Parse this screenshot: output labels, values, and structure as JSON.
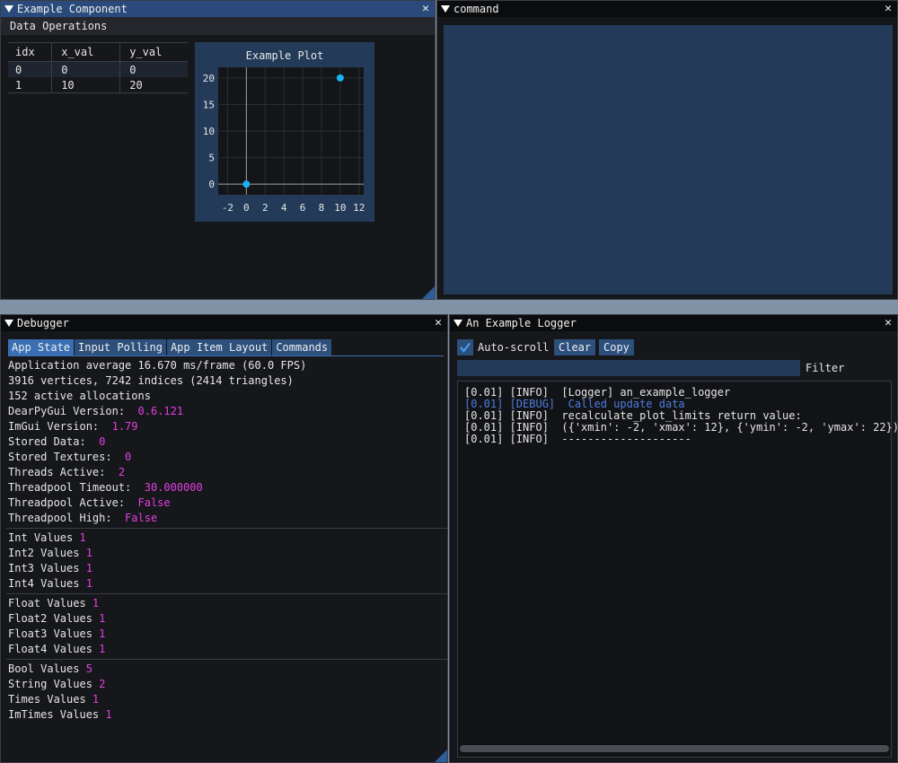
{
  "example_component": {
    "title": "Example Component",
    "menu": "Data Operations",
    "table": {
      "headers": [
        "idx",
        "x_val",
        "y_val"
      ],
      "rows": [
        [
          "0",
          "0",
          "0"
        ],
        [
          "1",
          "10",
          "20"
        ]
      ]
    }
  },
  "chart_data": {
    "type": "scatter",
    "title": "Example Plot",
    "x": [
      0,
      10
    ],
    "y": [
      0,
      20
    ],
    "xlim": [
      -3,
      12.5
    ],
    "ylim": [
      -2,
      22
    ],
    "xticks": [
      -2,
      0,
      2,
      4,
      6,
      8,
      10,
      12
    ],
    "yticks": [
      0,
      5,
      10,
      15,
      20
    ],
    "grid": true,
    "point_color": "#19b3f0",
    "axis_color": "#a0a0a0"
  },
  "command": {
    "title": "command"
  },
  "debugger": {
    "title": "Debugger",
    "tabs": [
      "App State",
      "Input Polling",
      "App Item Layout",
      "Commands"
    ],
    "lines": [
      {
        "label": "Application average 16.670 ms/frame (60.0 FPS)",
        "value": ""
      },
      {
        "label": "3916 vertices, 7242 indices (2414 triangles)",
        "value": ""
      },
      {
        "label": "152 active allocations",
        "value": ""
      },
      {
        "label": "DearPyGui Version:  ",
        "value": "0.6.121"
      },
      {
        "label": "ImGui Version:  ",
        "value": "1.79"
      },
      {
        "label": "Stored Data:  ",
        "value": "0"
      },
      {
        "label": "Stored Textures:  ",
        "value": "0"
      },
      {
        "label": "Threads Active:  ",
        "value": "2"
      },
      {
        "label": "Threadpool Timeout:  ",
        "value": "30.000000"
      },
      {
        "label": "Threadpool Active:  ",
        "value": "False"
      },
      {
        "label": "Threadpool High:  ",
        "value": "False"
      }
    ],
    "group1": [
      {
        "label": "Int Values ",
        "value": "1"
      },
      {
        "label": "Int2 Values ",
        "value": "1"
      },
      {
        "label": "Int3 Values ",
        "value": "1"
      },
      {
        "label": "Int4 Values ",
        "value": "1"
      }
    ],
    "group2": [
      {
        "label": "Float Values ",
        "value": "1"
      },
      {
        "label": "Float2 Values ",
        "value": "1"
      },
      {
        "label": "Float3 Values ",
        "value": "1"
      },
      {
        "label": "Float4 Values ",
        "value": "1"
      }
    ],
    "group3": [
      {
        "label": "Bool Values ",
        "value": "5"
      },
      {
        "label": "String Values ",
        "value": "2"
      },
      {
        "label": "Times Values ",
        "value": "1"
      },
      {
        "label": "ImTimes Values ",
        "value": "1"
      }
    ]
  },
  "logger": {
    "title": "An Example Logger",
    "autoscroll_label": "Auto-scroll",
    "clear_label": "Clear",
    "copy_label": "Copy",
    "filter_label": "Filter",
    "filter_value": "",
    "log": [
      {
        "text": "[0.01] [INFO]  [Logger] an_example_logger",
        "level": "info"
      },
      {
        "text": "[0.01] [DEBUG]  Called update data",
        "level": "debug"
      },
      {
        "text": "[0.01] [INFO]  recalculate_plot_limits return value:",
        "level": "info"
      },
      {
        "text": "[0.01] [INFO]  ({'xmin': -2, 'xmax': 12}, {'ymin': -2, 'ymax': 22})",
        "level": "info"
      },
      {
        "text": "[0.01] [INFO]  --------------------",
        "level": "info"
      }
    ]
  }
}
